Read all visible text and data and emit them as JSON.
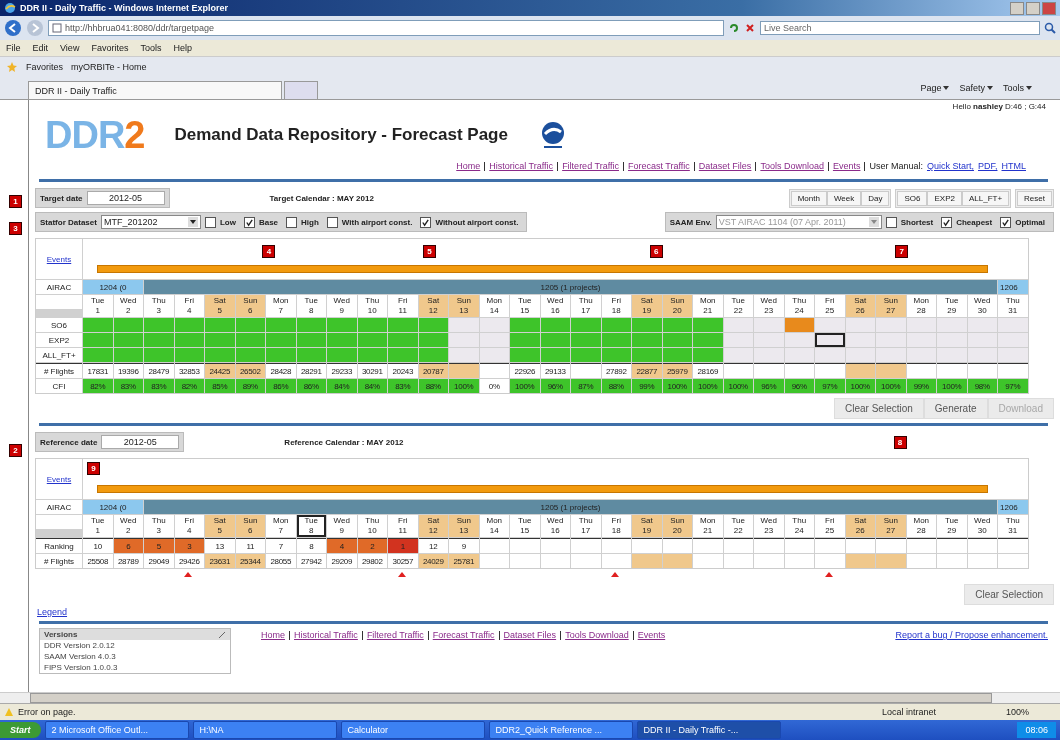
{
  "browser": {
    "title": "DDR II - Daily Traffic - Windows Internet Explorer",
    "address": "http://hhbrua041:8080/ddr/targetpage",
    "search_placeholder": "Live Search",
    "menu": [
      "File",
      "Edit",
      "View",
      "Favorites",
      "Tools",
      "Help"
    ],
    "favorites_label": "Favorites",
    "favorites": [
      "myORBITe - Home"
    ],
    "tab": "DDR II - Daily Traffic",
    "commands": [
      "Page",
      "Safety",
      "Tools"
    ]
  },
  "user": {
    "greeting": "Hello",
    "name": "nashley",
    "stats": "D:46 ; G:44"
  },
  "header": {
    "logo_letters": "DDR",
    "logo_digit": "2",
    "title": "Demand Data Repository - Forecast Page"
  },
  "nav": {
    "links": [
      "Home",
      "Historical Traffic",
      "Filtered Traffic",
      "Forecast Traffic",
      "Dataset Files",
      "Tools Download",
      "Events"
    ],
    "manual_label": "User Manual:",
    "manual_links": [
      "Quick Start,",
      "PDF,",
      "HTML"
    ]
  },
  "target": {
    "marker": "1",
    "label": "Target date",
    "value": "2012-05",
    "calendar": "Target Calendar : MAY 2012"
  },
  "view_buttons": [
    [
      "Month",
      "Week",
      "Day"
    ],
    [
      "SO6",
      "EXP2",
      "ALL_FT+"
    ],
    [
      "Reset"
    ]
  ],
  "dataset": {
    "marker": "3",
    "label": "Statfor Dataset",
    "value": "MTF_201202",
    "options": [
      {
        "label": "Low",
        "checked": false
      },
      {
        "label": "Base",
        "checked": true
      },
      {
        "label": "High",
        "checked": false
      },
      {
        "label": "With airport const.",
        "checked": false
      },
      {
        "label": "Without airport const.",
        "checked": true
      }
    ]
  },
  "saam": {
    "label": "SAAM Env.",
    "value": "VST AIRAC 1104 (07 Apr. 2011)",
    "disabled": true,
    "options": [
      {
        "label": "Shortest",
        "checked": false
      },
      {
        "label": "Cheapest",
        "checked": true
      },
      {
        "label": "Optimal",
        "checked": true
      }
    ]
  },
  "target_calendar": {
    "events_link": "Events",
    "markers": [
      "4",
      "5",
      "6",
      "7"
    ],
    "airac_label": "AIRAC",
    "airac": [
      {
        "label": "1204 (0",
        "kind": "past"
      },
      {
        "label": "1205 (1 projects)",
        "kind": "current"
      },
      {
        "label": "1206",
        "kind": "next"
      }
    ],
    "days": [
      {
        "day": "Tue",
        "date": "1",
        "weekend": false
      },
      {
        "day": "Wed",
        "date": "2",
        "weekend": false
      },
      {
        "day": "Thu",
        "date": "3",
        "weekend": false
      },
      {
        "day": "Fri",
        "date": "4",
        "weekend": false
      },
      {
        "day": "Sat",
        "date": "5",
        "weekend": true
      },
      {
        "day": "Sun",
        "date": "6",
        "weekend": true
      },
      {
        "day": "Mon",
        "date": "7",
        "weekend": false
      },
      {
        "day": "Tue",
        "date": "8",
        "weekend": false
      },
      {
        "day": "Wed",
        "date": "9",
        "weekend": false
      },
      {
        "day": "Thu",
        "date": "10",
        "weekend": false
      },
      {
        "day": "Fri",
        "date": "11",
        "weekend": false
      },
      {
        "day": "Sat",
        "date": "12",
        "weekend": true
      },
      {
        "day": "Sun",
        "date": "13",
        "weekend": true
      },
      {
        "day": "Mon",
        "date": "14",
        "weekend": false
      },
      {
        "day": "Tue",
        "date": "15",
        "weekend": false
      },
      {
        "day": "Wed",
        "date": "16",
        "weekend": false
      },
      {
        "day": "Thu",
        "date": "17",
        "weekend": false
      },
      {
        "day": "Fri",
        "date": "18",
        "weekend": false
      },
      {
        "day": "Sat",
        "date": "19",
        "weekend": true
      },
      {
        "day": "Sun",
        "date": "20",
        "weekend": true
      },
      {
        "day": "Mon",
        "date": "21",
        "weekend": false
      },
      {
        "day": "Tue",
        "date": "22",
        "weekend": false
      },
      {
        "day": "Wed",
        "date": "23",
        "weekend": false
      },
      {
        "day": "Thu",
        "date": "24",
        "weekend": false
      },
      {
        "day": "Fri",
        "date": "25",
        "weekend": false
      },
      {
        "day": "Sat",
        "date": "26",
        "weekend": true
      },
      {
        "day": "Sun",
        "date": "27",
        "weekend": true
      },
      {
        "day": "Mon",
        "date": "28",
        "weekend": false
      },
      {
        "day": "Tue",
        "date": "29",
        "weekend": false
      },
      {
        "day": "Wed",
        "date": "30",
        "weekend": false
      },
      {
        "day": "Thu",
        "date": "31",
        "weekend": false
      }
    ],
    "rows": [
      {
        "label": "SO6",
        "cells": [
          {
            "color": "#3ec42a",
            "selected": false
          },
          {
            "color": "#3ec42a",
            "selected": false
          },
          {
            "color": "#3ec42a",
            "selected": false
          },
          {
            "color": "#3ec42a",
            "selected": false
          },
          {
            "color": "#3ec42a",
            "selected": false
          },
          {
            "color": "#3ec42a",
            "selected": false
          },
          {
            "color": "#3ec42a",
            "selected": false
          },
          {
            "color": "#3ec42a",
            "selected": false
          },
          {
            "color": "#3ec42a",
            "selected": false
          },
          {
            "color": "#3ec42a",
            "selected": false
          },
          {
            "color": "#3ec42a",
            "selected": false
          },
          {
            "color": "#3ec42a",
            "selected": false
          },
          {
            "color": "#ece9ee",
            "selected": false
          },
          {
            "color": "#ece9ee",
            "selected": false
          },
          {
            "color": "#3ec42a",
            "selected": false
          },
          {
            "color": "#3ec42a",
            "selected": false
          },
          {
            "color": "#3ec42a",
            "selected": false
          },
          {
            "color": "#3ec42a",
            "selected": false
          },
          {
            "color": "#3ec42a",
            "selected": false
          },
          {
            "color": "#3ec42a",
            "selected": false
          },
          {
            "color": "#3ec42a",
            "selected": false
          },
          {
            "color": "#ece9ee",
            "selected": false
          },
          {
            "color": "#ece9ee",
            "selected": false
          },
          {
            "color": "#e88a1c",
            "selected": false
          },
          {
            "color": "#ece9ee",
            "selected": false
          },
          {
            "color": "#ece9ee",
            "selected": false
          },
          {
            "color": "#ece9ee",
            "selected": false
          },
          {
            "color": "#ece9ee",
            "selected": false
          },
          {
            "color": "#ece9ee",
            "selected": false
          },
          {
            "color": "#ece9ee",
            "selected": false
          },
          {
            "color": "#ece9ee",
            "selected": false
          }
        ]
      },
      {
        "label": "EXP2",
        "cells": [
          {
            "color": "#3ec42a",
            "selected": false
          },
          {
            "color": "#3ec42a",
            "selected": false
          },
          {
            "color": "#3ec42a",
            "selected": false
          },
          {
            "color": "#3ec42a",
            "selected": false
          },
          {
            "color": "#3ec42a",
            "selected": false
          },
          {
            "color": "#3ec42a",
            "selected": false
          },
          {
            "color": "#3ec42a",
            "selected": false
          },
          {
            "color": "#3ec42a",
            "selected": false
          },
          {
            "color": "#3ec42a",
            "selected": false
          },
          {
            "color": "#3ec42a",
            "selected": false
          },
          {
            "color": "#3ec42a",
            "selected": false
          },
          {
            "color": "#3ec42a",
            "selected": false
          },
          {
            "color": "#ece9ee",
            "selected": false
          },
          {
            "color": "#ece9ee",
            "selected": false
          },
          {
            "color": "#3ec42a",
            "selected": false
          },
          {
            "color": "#3ec42a",
            "selected": false
          },
          {
            "color": "#3ec42a",
            "selected": false
          },
          {
            "color": "#3ec42a",
            "selected": false
          },
          {
            "color": "#3ec42a",
            "selected": false
          },
          {
            "color": "#3ec42a",
            "selected": false
          },
          {
            "color": "#3ec42a",
            "selected": false
          },
          {
            "color": "#ece9ee",
            "selected": false
          },
          {
            "color": "#ece9ee",
            "selected": false
          },
          {
            "color": "#ece9ee",
            "selected": false
          },
          {
            "color": "#ece9ee",
            "selected": true
          },
          {
            "color": "#ece9ee",
            "selected": false
          },
          {
            "color": "#ece9ee",
            "selected": false
          },
          {
            "color": "#ece9ee",
            "selected": false
          },
          {
            "color": "#ece9ee",
            "selected": false
          },
          {
            "color": "#ece9ee",
            "selected": false
          },
          {
            "color": "#ece9ee",
            "selected": false
          }
        ]
      },
      {
        "label": "ALL_FT+",
        "cells": [
          {
            "color": "#3ec42a",
            "selected": false
          },
          {
            "color": "#3ec42a",
            "selected": false
          },
          {
            "color": "#3ec42a",
            "selected": false
          },
          {
            "color": "#3ec42a",
            "selected": false
          },
          {
            "color": "#3ec42a",
            "selected": false
          },
          {
            "color": "#3ec42a",
            "selected": false
          },
          {
            "color": "#3ec42a",
            "selected": false
          },
          {
            "color": "#3ec42a",
            "selected": false
          },
          {
            "color": "#3ec42a",
            "selected": false
          },
          {
            "color": "#3ec42a",
            "selected": false
          },
          {
            "color": "#3ec42a",
            "selected": false
          },
          {
            "color": "#3ec42a",
            "selected": false
          },
          {
            "color": "#ece9ee",
            "selected": false
          },
          {
            "color": "#ece9ee",
            "selected": false
          },
          {
            "color": "#3ec42a",
            "selected": false
          },
          {
            "color": "#3ec42a",
            "selected": false
          },
          {
            "color": "#3ec42a",
            "selected": false
          },
          {
            "color": "#3ec42a",
            "selected": false
          },
          {
            "color": "#3ec42a",
            "selected": false
          },
          {
            "color": "#3ec42a",
            "selected": false
          },
          {
            "color": "#3ec42a",
            "selected": false
          },
          {
            "color": "#ece9ee",
            "selected": false
          },
          {
            "color": "#ece9ee",
            "selected": false
          },
          {
            "color": "#ece9ee",
            "selected": false
          },
          {
            "color": "#ece9ee",
            "selected": false
          },
          {
            "color": "#ece9ee",
            "selected": false
          },
          {
            "color": "#ece9ee",
            "selected": false
          },
          {
            "color": "#ece9ee",
            "selected": false
          },
          {
            "color": "#ece9ee",
            "selected": false
          },
          {
            "color": "#ece9ee",
            "selected": false
          },
          {
            "color": "#ece9ee",
            "selected": false
          }
        ]
      }
    ],
    "flights_label": "# Flights",
    "flights": [
      {
        "kind": "value",
        "text": "17831"
      },
      {
        "kind": "value",
        "text": "19396"
      },
      {
        "kind": "value",
        "text": "28479"
      },
      {
        "kind": "value",
        "text": "32853"
      },
      {
        "kind": "value",
        "text": "24425"
      },
      {
        "kind": "value",
        "text": "26502"
      },
      {
        "kind": "value",
        "text": "28428"
      },
      {
        "kind": "value",
        "text": "28291"
      },
      {
        "kind": "value",
        "text": "29233"
      },
      {
        "kind": "value",
        "text": "30291"
      },
      {
        "kind": "value",
        "text": "20243"
      },
      {
        "kind": "value",
        "text": "20787"
      },
      {
        "kind": "empty"
      },
      {
        "kind": "empty"
      },
      {
        "kind": "value",
        "text": "22926"
      },
      {
        "kind": "value",
        "text": "29133"
      },
      {
        "kind": "empty"
      },
      {
        "kind": "value",
        "text": "27892"
      },
      {
        "kind": "value",
        "text": "22877"
      },
      {
        "kind": "value",
        "text": "25979"
      },
      {
        "kind": "value",
        "text": "28169"
      },
      {
        "kind": "empty"
      },
      {
        "kind": "empty"
      },
      {
        "kind": "empty"
      },
      {
        "kind": "empty"
      },
      {
        "kind": "empty"
      },
      {
        "kind": "empty"
      },
      {
        "kind": "empty"
      },
      {
        "kind": "empty"
      },
      {
        "kind": "empty"
      },
      {
        "kind": "empty"
      }
    ],
    "cfi_label": "CFI",
    "cfi": [
      {
        "text": "82%",
        "kind": "ok"
      },
      {
        "text": "83%",
        "kind": "ok"
      },
      {
        "text": "83%",
        "kind": "ok"
      },
      {
        "text": "82%",
        "kind": "ok"
      },
      {
        "text": "85%",
        "kind": "ok"
      },
      {
        "text": "89%",
        "kind": "ok"
      },
      {
        "text": "86%",
        "kind": "ok"
      },
      {
        "text": "86%",
        "kind": "ok"
      },
      {
        "text": "84%",
        "kind": "ok"
      },
      {
        "text": "84%",
        "kind": "ok"
      },
      {
        "text": "83%",
        "kind": "ok"
      },
      {
        "text": "88%",
        "kind": "ok"
      },
      {
        "text": "100%",
        "kind": "ok"
      },
      {
        "text": "0%",
        "kind": "none"
      },
      {
        "text": "100%",
        "kind": "ok"
      },
      {
        "text": "96%",
        "kind": "ok"
      },
      {
        "text": "87%",
        "kind": "ok"
      },
      {
        "text": "88%",
        "kind": "ok"
      },
      {
        "text": "99%",
        "kind": "ok"
      },
      {
        "text": "100%",
        "kind": "ok"
      },
      {
        "text": "100%",
        "kind": "ok"
      },
      {
        "text": "100%",
        "kind": "ok"
      },
      {
        "text": "96%",
        "kind": "ok"
      },
      {
        "text": "96%",
        "kind": "ok"
      },
      {
        "text": "97%",
        "kind": "ok"
      },
      {
        "text": "100%",
        "kind": "ok"
      },
      {
        "text": "100%",
        "kind": "ok"
      },
      {
        "text": "99%",
        "kind": "ok"
      },
      {
        "text": "100%",
        "kind": "ok"
      },
      {
        "text": "98%",
        "kind": "ok"
      },
      {
        "text": "97%",
        "kind": "ok"
      }
    ]
  },
  "actions": [
    {
      "label": "Clear Selection",
      "disabled": false
    },
    {
      "label": "Generate",
      "disabled": false
    },
    {
      "label": "Download",
      "disabled": true
    }
  ],
  "reference": {
    "marker": "2",
    "label": "Reference date",
    "value": "2012-05",
    "calendar": "Reference Calendar : MAY 2012",
    "side_marker": "8"
  },
  "reference_calendar": {
    "events_link": "Events",
    "marker": "9",
    "airac_label": "AIRAC",
    "airac": [
      {
        "label": "1204 (0",
        "kind": "past"
      },
      {
        "label": "1205 (1 projects)",
        "kind": "current"
      },
      {
        "label": "1206",
        "kind": "next"
      }
    ],
    "days": [
      {
        "day": "Tue",
        "date": "1",
        "weekend": false,
        "selected": false,
        "flagged": false
      },
      {
        "day": "Wed",
        "date": "2",
        "weekend": false,
        "selected": false,
        "flagged": false
      },
      {
        "day": "Thu",
        "date": "3",
        "weekend": false,
        "selected": false,
        "flagged": false
      },
      {
        "day": "Fri",
        "date": "4",
        "weekend": false,
        "selected": false,
        "flagged": true
      },
      {
        "day": "Sat",
        "date": "5",
        "weekend": true,
        "selected": false,
        "flagged": false
      },
      {
        "day": "Sun",
        "date": "6",
        "weekend": true,
        "selected": false,
        "flagged": false
      },
      {
        "day": "Mon",
        "date": "7",
        "weekend": false,
        "selected": false,
        "flagged": false
      },
      {
        "day": "Tue",
        "date": "8",
        "weekend": false,
        "selected": true,
        "flagged": false
      },
      {
        "day": "Wed",
        "date": "9",
        "weekend": false,
        "selected": false,
        "flagged": false
      },
      {
        "day": "Thu",
        "date": "10",
        "weekend": false,
        "selected": false,
        "flagged": false
      },
      {
        "day": "Fri",
        "date": "11",
        "weekend": false,
        "selected": false,
        "flagged": true
      },
      {
        "day": "Sat",
        "date": "12",
        "weekend": true,
        "selected": false,
        "flagged": false
      },
      {
        "day": "Sun",
        "date": "13",
        "weekend": true,
        "selected": false,
        "flagged": false
      },
      {
        "day": "Mon",
        "date": "14",
        "weekend": false,
        "selected": false,
        "flagged": false
      },
      {
        "day": "Tue",
        "date": "15",
        "weekend": false,
        "selected": false,
        "flagged": false
      },
      {
        "day": "Wed",
        "date": "16",
        "weekend": false,
        "selected": false,
        "flagged": false
      },
      {
        "day": "Thu",
        "date": "17",
        "weekend": false,
        "selected": false,
        "flagged": false
      },
      {
        "day": "Fri",
        "date": "18",
        "weekend": false,
        "selected": false,
        "flagged": true
      },
      {
        "day": "Sat",
        "date": "19",
        "weekend": true,
        "selected": false,
        "flagged": false
      },
      {
        "day": "Sun",
        "date": "20",
        "weekend": true,
        "selected": false,
        "flagged": false
      },
      {
        "day": "Mon",
        "date": "21",
        "weekend": false,
        "selected": false,
        "flagged": false
      },
      {
        "day": "Tue",
        "date": "22",
        "weekend": false,
        "selected": false,
        "flagged": false
      },
      {
        "day": "Wed",
        "date": "23",
        "weekend": false,
        "selected": false,
        "flagged": false
      },
      {
        "day": "Thu",
        "date": "24",
        "weekend": false,
        "selected": false,
        "flagged": false
      },
      {
        "day": "Fri",
        "date": "25",
        "weekend": false,
        "selected": false,
        "flagged": true
      },
      {
        "day": "Sat",
        "date": "26",
        "weekend": true,
        "selected": false,
        "flagged": false
      },
      {
        "day": "Sun",
        "date": "27",
        "weekend": true,
        "selected": false,
        "flagged": false
      },
      {
        "day": "Mon",
        "date": "28",
        "weekend": false,
        "selected": false,
        "flagged": false
      },
      {
        "day": "Tue",
        "date": "29",
        "weekend": false,
        "selected": false,
        "flagged": false
      },
      {
        "day": "Wed",
        "date": "30",
        "weekend": false,
        "selected": false,
        "flagged": false
      },
      {
        "day": "Thu",
        "date": "31",
        "weekend": false,
        "selected": false,
        "flagged": false
      }
    ],
    "ranking_label": "Ranking",
    "ranking": [
      {
        "kind": "value",
        "text": "10",
        "color": "#ffffff"
      },
      {
        "kind": "value",
        "text": "6",
        "color": "#e06a28"
      },
      {
        "kind": "value",
        "text": "5",
        "color": "#e06a28"
      },
      {
        "kind": "value",
        "text": "3",
        "color": "#e06a28"
      },
      {
        "kind": "value",
        "text": "13",
        "color": "#ffffff"
      },
      {
        "kind": "value",
        "text": "11",
        "color": "#ffffff"
      },
      {
        "kind": "value",
        "text": "7",
        "color": "#ffffff"
      },
      {
        "kind": "value",
        "text": "8",
        "color": "#ffffff"
      },
      {
        "kind": "value",
        "text": "4",
        "color": "#e06a28"
      },
      {
        "kind": "value",
        "text": "2",
        "color": "#e06a28"
      },
      {
        "kind": "value",
        "text": "1",
        "color": "#d2331f"
      },
      {
        "kind": "value",
        "text": "12",
        "color": "#ffffff"
      },
      {
        "kind": "value",
        "text": "9",
        "color": "#ffffff"
      },
      {
        "kind": "empty"
      },
      {
        "kind": "empty"
      },
      {
        "kind": "empty"
      },
      {
        "kind": "empty"
      },
      {
        "kind": "empty"
      },
      {
        "kind": "empty"
      },
      {
        "kind": "empty"
      },
      {
        "kind": "empty"
      },
      {
        "kind": "empty"
      },
      {
        "kind": "empty"
      },
      {
        "kind": "empty"
      },
      {
        "kind": "empty"
      },
      {
        "kind": "empty"
      },
      {
        "kind": "empty"
      },
      {
        "kind": "empty"
      },
      {
        "kind": "empty"
      },
      {
        "kind": "empty"
      },
      {
        "kind": "empty"
      }
    ],
    "flights_label": "# Flights",
    "flights": [
      {
        "kind": "value",
        "text": "25508"
      },
      {
        "kind": "value",
        "text": "28789"
      },
      {
        "kind": "value",
        "text": "29049"
      },
      {
        "kind": "value",
        "text": "29426"
      },
      {
        "kind": "value",
        "text": "23631"
      },
      {
        "kind": "value",
        "text": "25344"
      },
      {
        "kind": "value",
        "text": "28055"
      },
      {
        "kind": "value",
        "text": "27942"
      },
      {
        "kind": "value",
        "text": "29209"
      },
      {
        "kind": "value",
        "text": "29802"
      },
      {
        "kind": "value",
        "text": "30257"
      },
      {
        "kind": "value",
        "text": "24029"
      },
      {
        "kind": "value",
        "text": "25781"
      },
      {
        "kind": "empty"
      },
      {
        "kind": "empty"
      },
      {
        "kind": "empty"
      },
      {
        "kind": "empty"
      },
      {
        "kind": "empty"
      },
      {
        "kind": "empty"
      },
      {
        "kind": "empty"
      },
      {
        "kind": "empty"
      },
      {
        "kind": "empty"
      },
      {
        "kind": "empty"
      },
      {
        "kind": "empty"
      },
      {
        "kind": "empty"
      },
      {
        "kind": "empty"
      },
      {
        "kind": "empty"
      },
      {
        "kind": "empty"
      },
      {
        "kind": "empty"
      },
      {
        "kind": "empty"
      },
      {
        "kind": "empty"
      }
    ]
  },
  "reference_actions": [
    {
      "label": "Clear Selection",
      "disabled": false
    }
  ],
  "legend": "Legend",
  "versions": {
    "title": "Versions",
    "lines": [
      "DDR Version 2.0.12",
      "SAAM Version 4.0.3",
      "FIPS Version 1.0.0.3"
    ]
  },
  "footer": {
    "links": [
      "Home",
      "Historical Traffic",
      "Filtered Traffic",
      "Forecast Traffic",
      "Dataset Files",
      "Tools Download",
      "Events"
    ],
    "report": "Report a bug / Propose enhancement."
  },
  "status_bar": {
    "message": "Error on page.",
    "zone": "Local intranet",
    "zoom": "100%"
  },
  "taskbar": {
    "start": "Start",
    "items": [
      {
        "label": "2 Microsoft Office Outl...",
        "selected": false
      },
      {
        "label": "H:\\NA",
        "selected": false
      },
      {
        "label": "Calculator",
        "selected": false
      },
      {
        "label": "DDR2_Quick Reference ...",
        "selected": false
      },
      {
        "label": "DDR II - Daily Traffic -...",
        "selected": true
      }
    ],
    "clock": "08:06"
  }
}
